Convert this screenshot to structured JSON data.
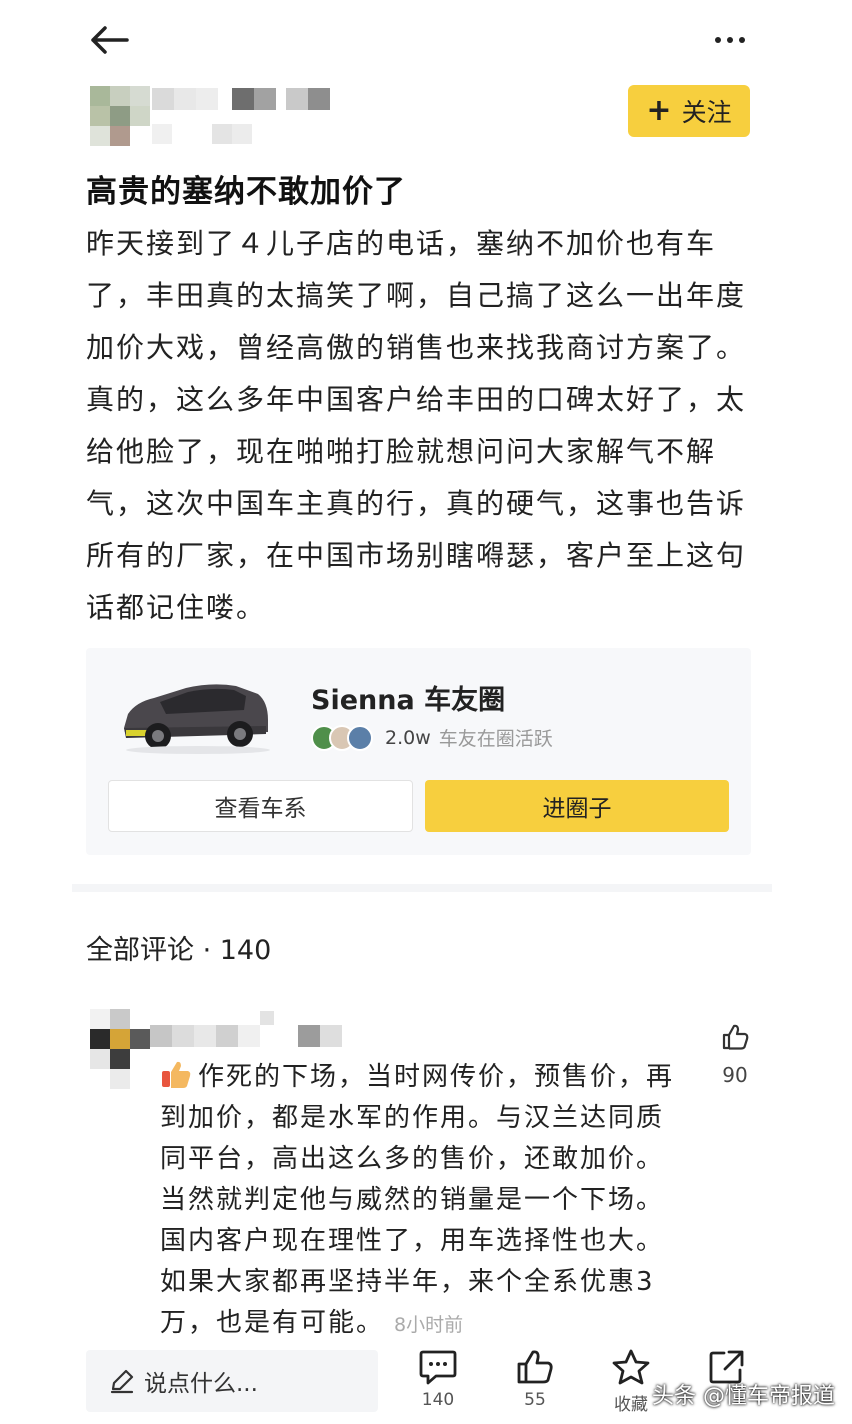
{
  "nav": {
    "back_icon": "arrow-left-icon",
    "more_icon": "more-dots-icon"
  },
  "follow_button": {
    "label": "关注",
    "icon": "plus-icon"
  },
  "post": {
    "title": "高贵的塞纳不敢加价了",
    "body": "昨天接到了４儿子店的电话，塞纳不加价也有车了，丰田真的太搞笑了啊，自己搞了这么一出年度加价大戏，曾经高傲的销售也来找我商讨方案了。真的，这么多年中国客户给丰田的口碑太好了，太给他脸了，现在啪啪打脸就想问问大家解气不解气，这次中国车主真的行，真的硬气，这事也告诉所有的厂家，在中国市场别瞎嘚瑟，客户至上这句话都记住喽。"
  },
  "circle": {
    "name": "Sienna 车友圈",
    "member_count": "2.0w",
    "member_text": "车友在圈活跃",
    "view_series_label": "查看车系",
    "join_label": "进圈子"
  },
  "comments": {
    "header_label": "全部评论",
    "separator": " · ",
    "count": "140",
    "items": [
      {
        "text": "作死的下场，当时网传价，预售价，再到加价，都是水军的作用。与汉兰达同质同平台，高出这么多的售价，还敢加价。当然就判定他与威然的销量是一个下场。国内客户现在理性了，用车选择性也大。如果大家都再坚持半年，来个全系优惠3万，也是有可能。",
        "time": "8小时前",
        "likes": "90"
      }
    ]
  },
  "bottom_bar": {
    "placeholder": "说点什么...",
    "comment_count": "140",
    "like_count": "55",
    "favorite_label": "收藏",
    "watermark": "头条 @懂车帝报道"
  },
  "colors": {
    "accent": "#f7cf3e",
    "card_bg": "#f7f8fa",
    "divider": "#f4f5f7"
  }
}
